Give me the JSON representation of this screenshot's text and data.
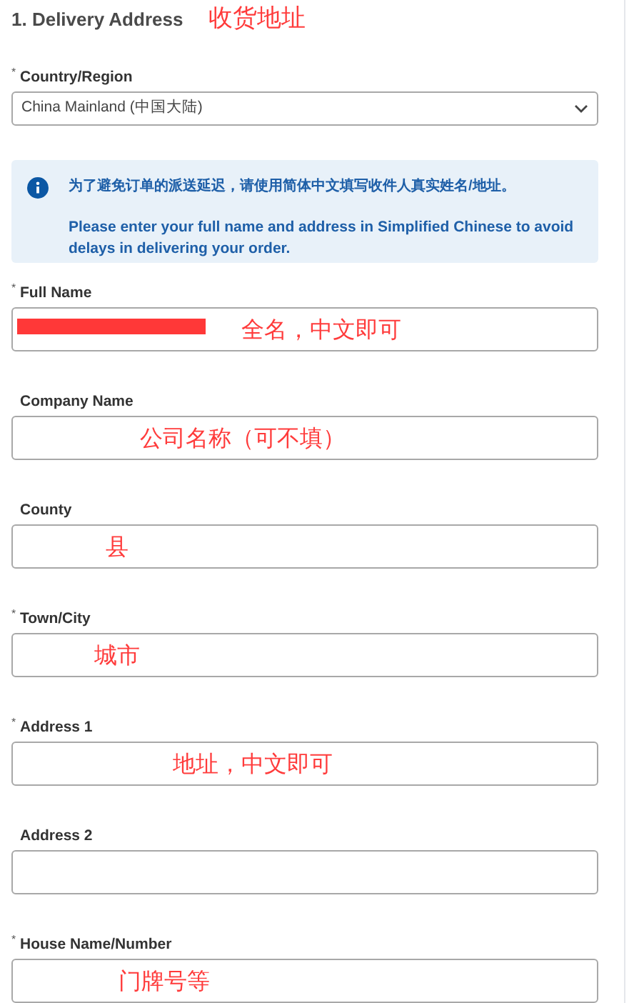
{
  "section_title": "1. Delivery Address",
  "title_annotation": "收货地址",
  "country": {
    "required_mark": "*",
    "label": "Country/Region",
    "value": "China Mainland (中国大陆)"
  },
  "notice": {
    "chinese": "为了避免订单的派送延迟，请使用简体中文填写收件人真实姓名/地址。",
    "english": "Please enter your full name and address in Simplified Chinese to avoid delays in delivering your order."
  },
  "fields": [
    {
      "required_mark": "*",
      "label": "Full Name",
      "redacted": true,
      "annotation": "全名，中文即可"
    },
    {
      "label": "Company Name",
      "redacted": false,
      "annotation": "公司名称（可不填）"
    },
    {
      "label": "County",
      "redacted": false,
      "annotation": "县"
    },
    {
      "required_mark": "*",
      "label": "Town/City",
      "redacted": false,
      "annotation": "城市"
    },
    {
      "required_mark": "*",
      "label": "Address 1",
      "redacted": false,
      "annotation": "地址，中文即可"
    },
    {
      "label": "Address 2",
      "redacted": false
    },
    {
      "required_mark": "*",
      "label": "House Name/Number",
      "redacted": false,
      "annotation": "门牌号等"
    }
  ]
}
